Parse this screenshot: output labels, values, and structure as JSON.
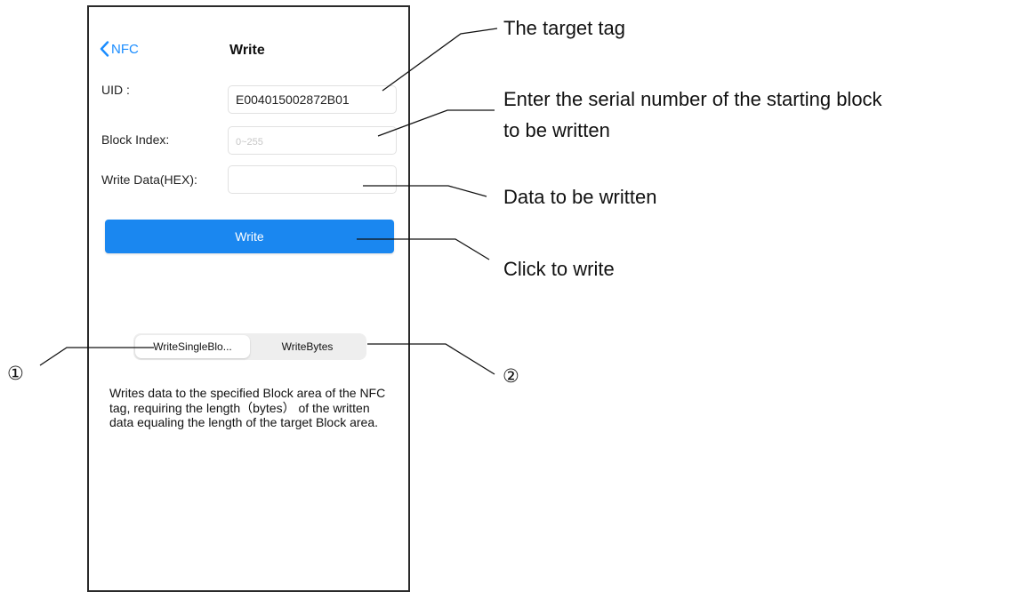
{
  "screen": {
    "back_label": "NFC",
    "title": "Write",
    "uid_label": "UID :",
    "uid_value": "E004015002872B01",
    "block_index_label": "Block Index:",
    "block_index_placeholder": "0~255",
    "write_data_label": "Write Data(HEX):",
    "write_data_value": "",
    "write_button": "Write",
    "segments": [
      "WriteSingleBlo...",
      "WriteBytes"
    ],
    "selected_segment": "WriteSingleBlo...",
    "description": "Writes data to the specified Block area of the NFC tag, requiring the length（bytes） of the written data equaling the length of the target Block area."
  },
  "annotations": {
    "target_tag": "The target tag",
    "starting_block_line1": "Enter the serial number of the starting block",
    "starting_block_line2": "to be written",
    "data_to_write": "Data to be written",
    "click_to_write": "Click to write",
    "marker_1": "①",
    "marker_2": "②"
  },
  "colors": {
    "accent": "#1a87f0",
    "back_link": "#1a8cff"
  }
}
